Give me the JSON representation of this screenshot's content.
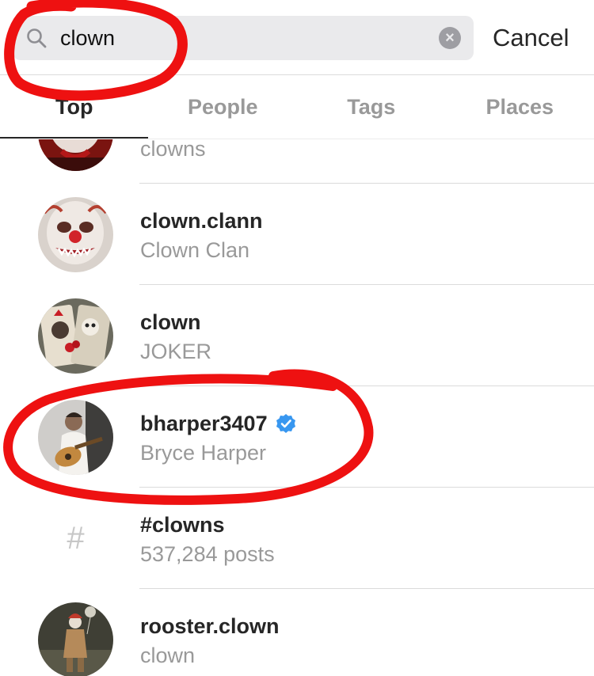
{
  "search": {
    "query": "clown",
    "cancel_label": "Cancel"
  },
  "tabs": [
    "Top",
    "People",
    "Tags",
    "Places"
  ],
  "active_tab": "Top",
  "results": [
    {
      "username": "",
      "subtitle": "clowns",
      "kind": "user",
      "avatar": "red-clown"
    },
    {
      "username": "clown.clann",
      "subtitle": "Clown Clan",
      "kind": "user",
      "avatar": "scary-clown"
    },
    {
      "username": "clown",
      "subtitle": "JOKER",
      "kind": "user",
      "avatar": "joker-card"
    },
    {
      "username": "bharper3407",
      "subtitle": "Bryce Harper",
      "kind": "user",
      "verified": true,
      "avatar": "guitar-player"
    },
    {
      "username": "#clowns",
      "subtitle": "537,284 posts",
      "kind": "hashtag",
      "icon": "#"
    },
    {
      "username": "rooster.clown",
      "subtitle": "clown",
      "kind": "user",
      "avatar": "standing-clown"
    }
  ],
  "colors": {
    "annotation_red": "#ee1111",
    "verified_blue": "#3897f0",
    "muted_text": "#999999",
    "primary_text": "#262626"
  }
}
